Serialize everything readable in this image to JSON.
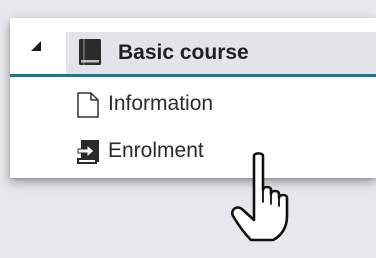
{
  "tree": {
    "course": {
      "title": "Basic course",
      "expanded": true,
      "toggle_icon": "triangle-expanded-icon",
      "icon": "book-icon"
    },
    "items": [
      {
        "label": "Information",
        "icon": "document-icon"
      },
      {
        "label": "Enrolment",
        "icon": "enrolment-icon"
      }
    ]
  },
  "cursor": {
    "icon": "hand-pointer-icon"
  },
  "colors": {
    "accent": "#0e7c92",
    "course_background": "#e2e4e7",
    "page_background": "#e6e8eb"
  }
}
